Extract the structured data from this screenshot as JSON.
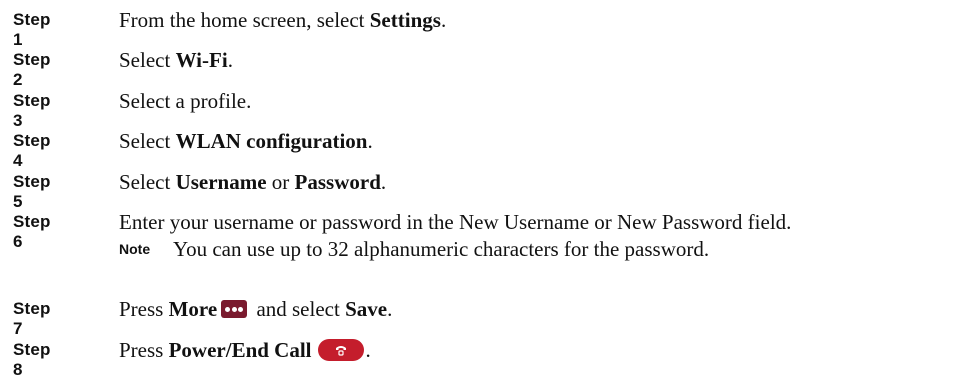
{
  "steps": [
    {
      "label": "Step 1",
      "pre": "From the home screen, select ",
      "bold": "Settings",
      "post": "."
    },
    {
      "label": "Step 2",
      "pre": "Select ",
      "bold": "Wi-Fi",
      "post": "."
    },
    {
      "label": "Step 3",
      "text": "Select a profile."
    },
    {
      "label": "Step 4",
      "pre": "Select ",
      "bold": "WLAN configuration",
      "post": "."
    },
    {
      "label": "Step 5",
      "pre": "Select ",
      "bold1": "Username",
      "mid": " or ",
      "bold2": "Password",
      "post": "."
    },
    {
      "label": "Step 6",
      "text": "Enter your username or password in the New Username or New Password field.",
      "note_label": "Note",
      "note_text": "You can use up to 32 alphanumeric characters for the password."
    },
    {
      "label": "Step 7",
      "pre": "Press ",
      "bold1": "More",
      "mid": " and select ",
      "bold2": "Save",
      "post": "."
    },
    {
      "label": "Step 8",
      "pre": "Press ",
      "bold": "Power/End Call",
      "post": "."
    }
  ],
  "icons": {
    "more": "more-softkey-icon",
    "end_call": "end-call-icon",
    "more_color": "#7a1a2e",
    "end_call_color": "#c41d2c"
  }
}
